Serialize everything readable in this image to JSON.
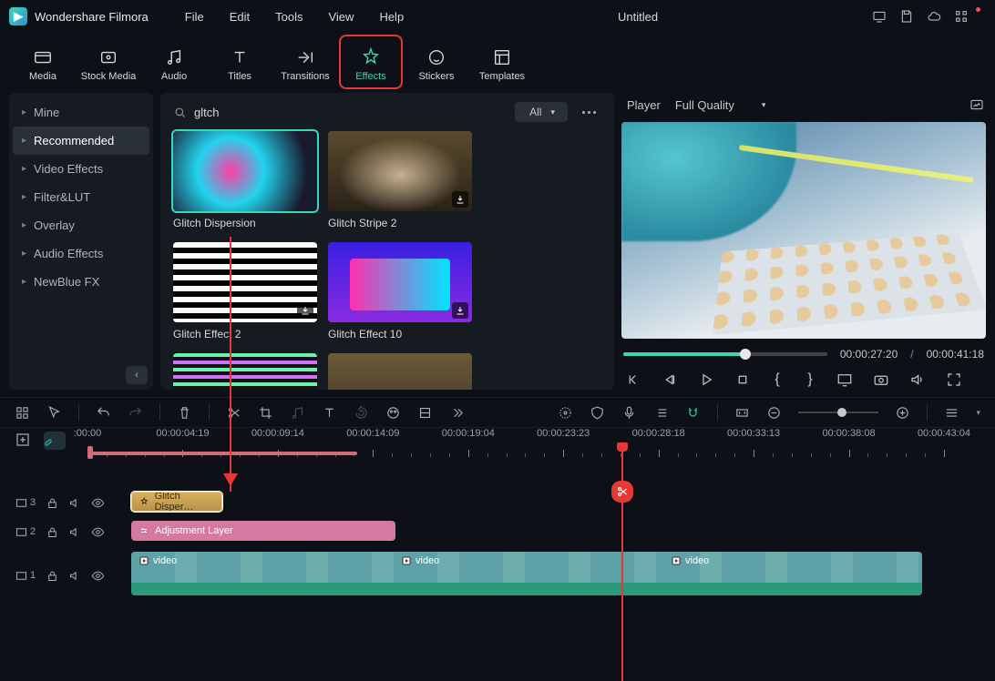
{
  "app": {
    "name": "Wondershare Filmora",
    "project": "Untitled"
  },
  "menu": {
    "file": "File",
    "edit": "Edit",
    "tools": "Tools",
    "view": "View",
    "help": "Help"
  },
  "toolbar": {
    "media": "Media",
    "stock": "Stock Media",
    "audio": "Audio",
    "titles": "Titles",
    "transitions": "Transitions",
    "effects": "Effects",
    "stickers": "Stickers",
    "templates": "Templates"
  },
  "sidebar": {
    "items": [
      "Mine",
      "Recommended",
      "Video Effects",
      "Filter&LUT",
      "Overlay",
      "Audio Effects",
      "NewBlue FX"
    ],
    "active": 1
  },
  "search": {
    "placeholder": "",
    "value": "gltch"
  },
  "filter": {
    "label": "All"
  },
  "effects": {
    "items": [
      {
        "label": "Glitch Dispersion",
        "selected": true,
        "dl": false
      },
      {
        "label": "Glitch Stripe 2",
        "selected": false,
        "dl": true
      },
      {
        "label": "Glitch Effect 2",
        "selected": false,
        "dl": true
      },
      {
        "label": "Glitch Effect 10",
        "selected": false,
        "dl": true
      }
    ]
  },
  "preview": {
    "player": "Player",
    "quality": "Full Quality",
    "current": "00:00:27:20",
    "total": "00:00:41:18",
    "sep": "/"
  },
  "ruler": {
    "labels": [
      ":00:00",
      "00:00:04:19",
      "00:00:09:14",
      "00:00:14:09",
      "00:00:19:04",
      "00:00:23:23",
      "00:00:28:18",
      "00:00:33:13",
      "00:00:38:08",
      "00:00:43:04"
    ]
  },
  "tracks": {
    "t3": "3",
    "t2": "2",
    "t1": "1",
    "effect_clip": "Glitch Disper…",
    "adj_clip": "Adjustment Layer",
    "video_label": "video"
  }
}
